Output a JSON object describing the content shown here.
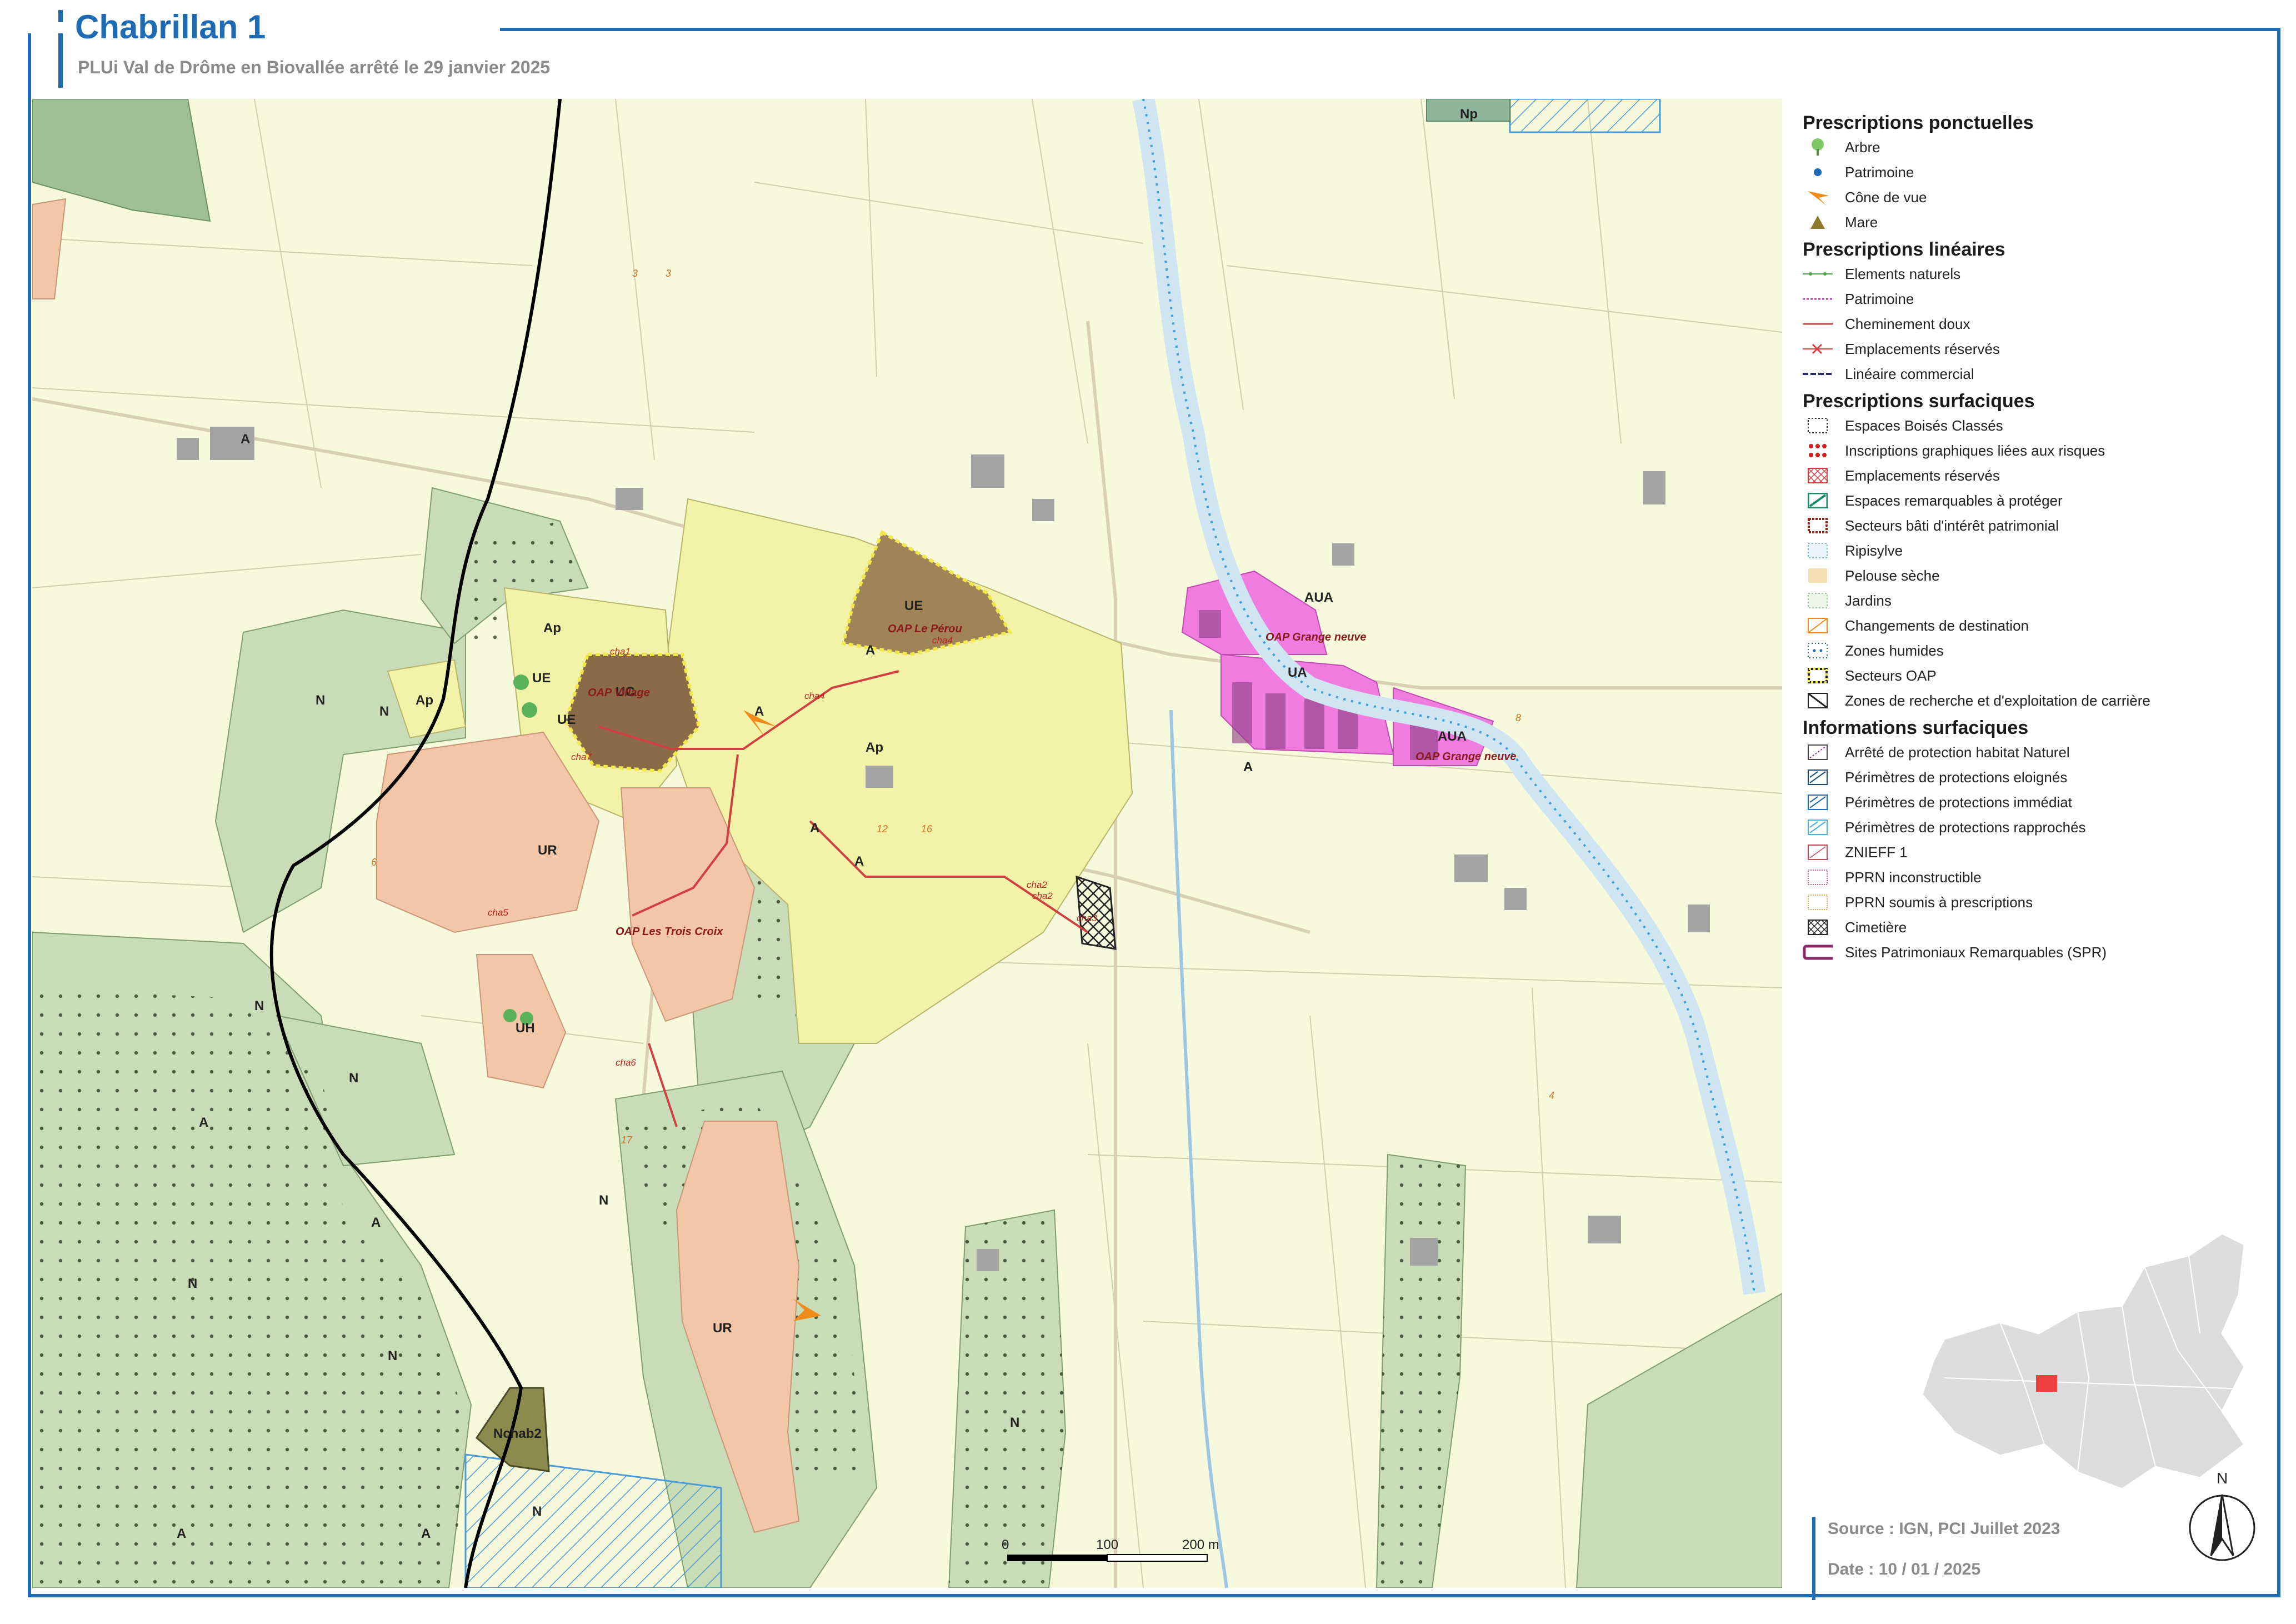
{
  "header": {
    "title": "Chabrillan 1",
    "subtitle": "PLUi Val de Drôme en Biovallée arrêté le 29 janvier 2025"
  },
  "legend": {
    "ponctuelles": {
      "title": "Prescriptions ponctuelles",
      "items": [
        "Arbre",
        "Patrimoine",
        "Cône de vue",
        "Mare"
      ]
    },
    "lineaires": {
      "title": "Prescriptions linéaires",
      "items": [
        "Elements naturels",
        "Patrimoine",
        "Cheminement doux",
        "Emplacements réservés",
        "Linéaire commercial"
      ]
    },
    "surfaciques": {
      "title": "Prescriptions surfaciques",
      "items": [
        "Espaces Boisés Classés",
        "Inscriptions graphiques liées aux risques",
        "Emplacements réservés",
        "Espaces remarquables à protéger",
        "Secteurs bâti d'intérêt patrimonial",
        "Ripisylve",
        "Pelouse sèche",
        "Jardins",
        "Changements de destination",
        "Zones humides",
        "Secteurs OAP",
        "Zones de recherche et d'exploitation de carrière"
      ]
    },
    "informations": {
      "title": "Informations surfaciques",
      "items": [
        "Arrêté de protection habitat Naturel",
        "Périmètres de protections eloignés",
        "Périmètres de protections immédiat",
        "Périmètres de protections rapprochés",
        "ZNIEFF 1",
        "PPRN inconstructible",
        "PPRN soumis à prescriptions",
        "Cimetière",
        "Sites Patrimoniaux Remarquables (SPR)"
      ]
    }
  },
  "map": {
    "zones": [
      "A",
      "A",
      "A",
      "A",
      "A",
      "A",
      "A",
      "A",
      "A",
      "A",
      "Ap",
      "Ap",
      "Ap",
      "N",
      "N",
      "N",
      "N",
      "N",
      "N",
      "N",
      "N",
      "N",
      "UE",
      "UE",
      "UE",
      "UC",
      "UR",
      "UR",
      "UH",
      "UA",
      "AUA",
      "AUA",
      "Np",
      "Nchab2"
    ],
    "oap": [
      "OAP Village",
      "OAP Le Pérou",
      "OAP Les Trois Croix",
      "OAP Grange neuve",
      "OAP Grange neuve"
    ],
    "chemins": [
      "cha1",
      "cha2",
      "cha2",
      "cha3",
      "cha4",
      "cha4",
      "cha5",
      "cha6",
      "cha7"
    ],
    "numeros": [
      "3",
      "3",
      "6",
      "12",
      "16",
      "17",
      "4",
      "8"
    ],
    "scalebar": [
      "0",
      "100",
      "200 m"
    ],
    "north_label": "N"
  },
  "footer": {
    "source": "Source : IGN, PCI Juillet 2023",
    "date": "Date : 10 / 01 / 2025"
  },
  "colors": {
    "frame": "#1f6bb3",
    "agricole": "#f6f9dc",
    "naturel": "#c9dcb8",
    "naturel_dark": "#9fbf95",
    "urbain_residentiel": "#f3c6a8",
    "centre": "#8b6a48",
    "oap_jaune": "#f2f2a8",
    "activite": "#f07ce0",
    "riviere": "#3aa0d8"
  }
}
